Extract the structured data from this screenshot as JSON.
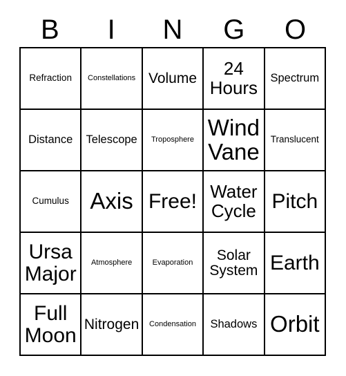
{
  "card": {
    "headers": [
      "B",
      "I",
      "N",
      "G",
      "O"
    ],
    "rows": [
      [
        {
          "text": "Refraction",
          "size": "fs-s"
        },
        {
          "text": "Constellations",
          "size": "fs-xs"
        },
        {
          "text": "Volume",
          "size": "fs-l"
        },
        {
          "text": "24\nHours",
          "size": "fs-xl"
        },
        {
          "text": "Spectrum",
          "size": "fs-m"
        }
      ],
      [
        {
          "text": "Distance",
          "size": "fs-m"
        },
        {
          "text": "Telescope",
          "size": "fs-m"
        },
        {
          "text": "Troposphere",
          "size": "fs-xs"
        },
        {
          "text": "Wind\nVane",
          "size": "fs-huge"
        },
        {
          "text": "Translucent",
          "size": "fs-s"
        }
      ],
      [
        {
          "text": "Cumulus",
          "size": "fs-s"
        },
        {
          "text": "Axis",
          "size": "fs-huge"
        },
        {
          "text": "Free!",
          "size": "fs-xxl"
        },
        {
          "text": "Water\nCycle",
          "size": "fs-xl"
        },
        {
          "text": "Pitch",
          "size": "fs-xxl"
        }
      ],
      [
        {
          "text": "Ursa\nMajor",
          "size": "fs-xxl"
        },
        {
          "text": "Atmosphere",
          "size": "fs-xs"
        },
        {
          "text": "Evaporation",
          "size": "fs-xs"
        },
        {
          "text": "Solar\nSystem",
          "size": "fs-l"
        },
        {
          "text": "Earth",
          "size": "fs-xxl"
        }
      ],
      [
        {
          "text": "Full\nMoon",
          "size": "fs-xxl"
        },
        {
          "text": "Nitrogen",
          "size": "fs-l"
        },
        {
          "text": "Condensation",
          "size": "fs-xs"
        },
        {
          "text": "Shadows",
          "size": "fs-m"
        },
        {
          "text": "Orbit",
          "size": "fs-huge"
        }
      ]
    ]
  },
  "colors": {
    "background": "#ffffff",
    "border": "#000000",
    "text": "#000000"
  }
}
